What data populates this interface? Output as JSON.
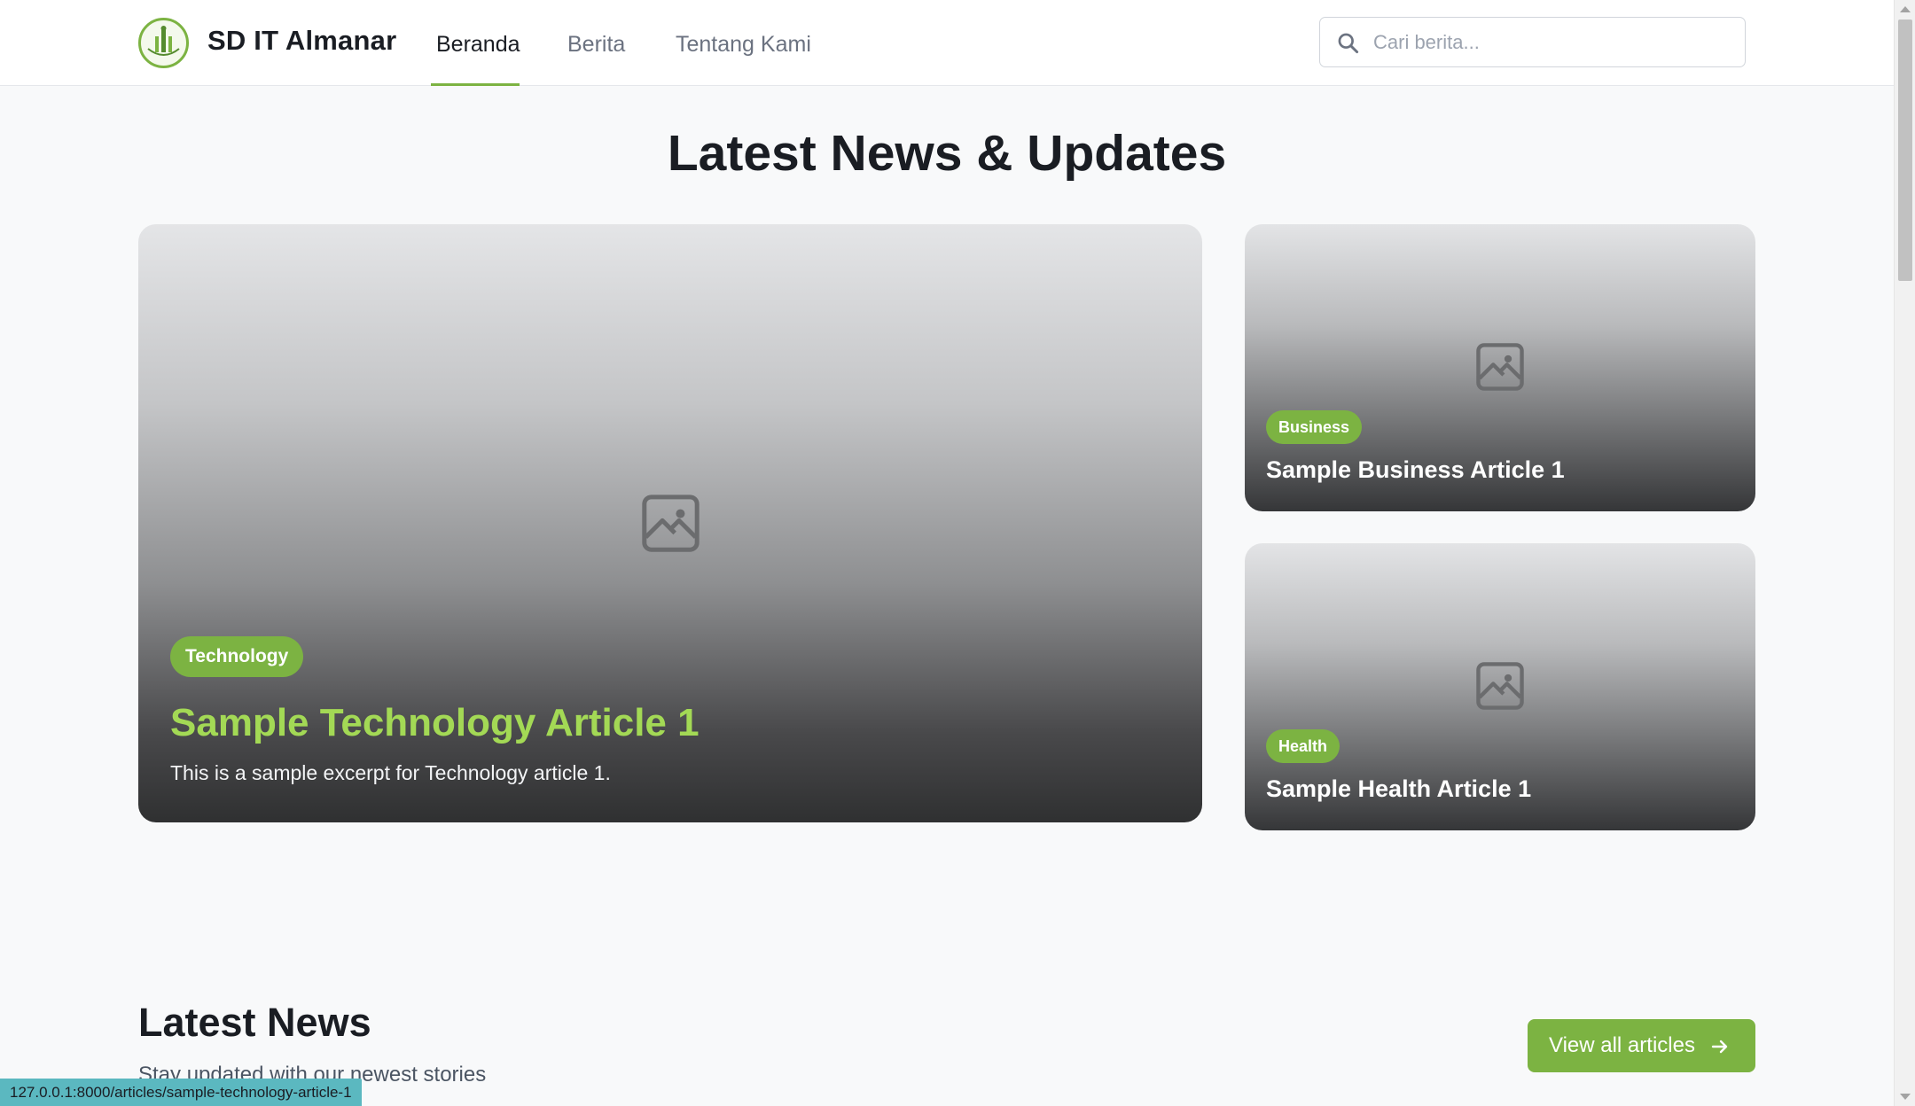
{
  "header": {
    "brand": "SD IT Almanar",
    "nav": [
      {
        "label": "Beranda",
        "active": true
      },
      {
        "label": "Berita",
        "active": false
      },
      {
        "label": "Tentang Kami",
        "active": false
      }
    ],
    "search_placeholder": "Cari berita..."
  },
  "hero": {
    "title": "Latest News & Updates",
    "featured": {
      "category": "Technology",
      "title": "Sample Technology Article 1",
      "excerpt": "This is a sample excerpt for Technology article 1.",
      "icon": "image-placeholder-icon"
    },
    "side": [
      {
        "category": "Business",
        "title": "Sample Business Article 1",
        "icon": "image-placeholder-icon"
      },
      {
        "category": "Health",
        "title": "Sample Health Article 1",
        "icon": "image-placeholder-icon"
      }
    ]
  },
  "latest": {
    "title": "Latest News",
    "subtitle": "Stay updated with our newest stories",
    "view_all_label": "View all articles"
  },
  "status_url": "127.0.0.1:8000/articles/sample-technology-article-1",
  "colors": {
    "accent": "#7cb342",
    "featured_title": "#a3d955",
    "status_bar": "#5bb8c0"
  }
}
